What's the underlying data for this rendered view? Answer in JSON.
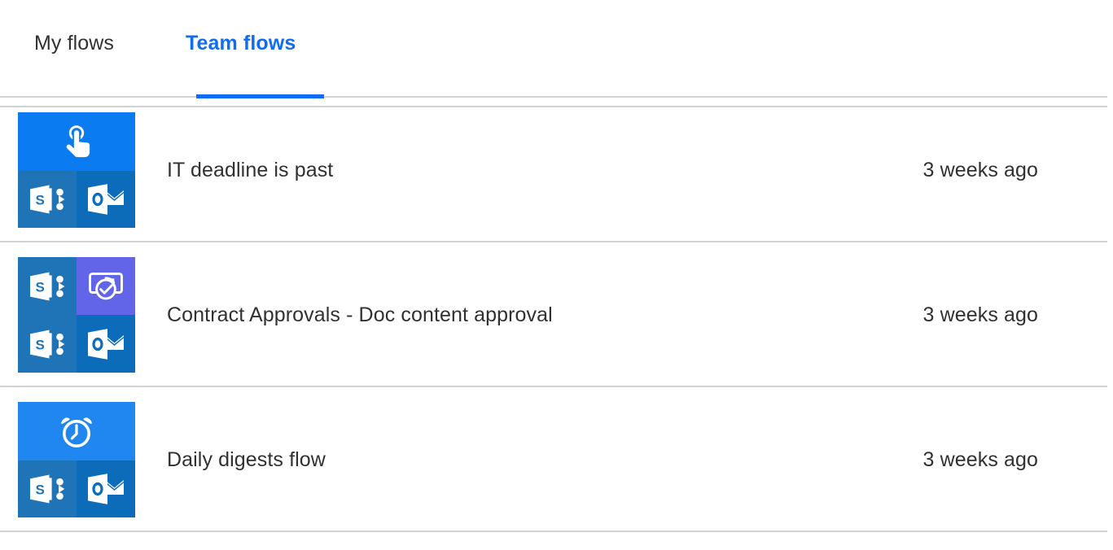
{
  "colors": {
    "accent": "#0f6cf5",
    "divider": "#d2d2d2",
    "text": "#323130",
    "tile_trigger_blue": "#0a7bf0",
    "tile_sharepoint_blue": "#1f73b7",
    "tile_outlook_blue": "#0d6cba",
    "tile_approvals_purple": "#6265e8"
  },
  "tabs": {
    "items": [
      {
        "label": "My flows",
        "active": false
      },
      {
        "label": "Team flows",
        "active": true
      }
    ]
  },
  "flows": [
    {
      "title": "IT deadline is past",
      "modified": "3 weeks ago",
      "layout": "top-wide",
      "icons": [
        {
          "name": "manual-trigger-button-icon",
          "bg": "#0a7bf0"
        },
        {
          "name": "sharepoint-icon",
          "bg": "#1f73b7"
        },
        {
          "name": "outlook-icon",
          "bg": "#0d6cba"
        }
      ]
    },
    {
      "title": "Contract Approvals - Doc content approval",
      "modified": "3 weeks ago",
      "layout": "quad",
      "icons": [
        {
          "name": "sharepoint-icon",
          "bg": "#1f73b7"
        },
        {
          "name": "approvals-icon",
          "bg": "#6265e8"
        },
        {
          "name": "sharepoint-icon",
          "bg": "#1f73b7"
        },
        {
          "name": "outlook-icon",
          "bg": "#0d6cba"
        }
      ]
    },
    {
      "title": "Daily digests flow",
      "modified": "3 weeks ago",
      "layout": "top-wide",
      "icons": [
        {
          "name": "recurrence-alarm-clock-icon",
          "bg": "#2187f0"
        },
        {
          "name": "sharepoint-icon",
          "bg": "#1f73b7"
        },
        {
          "name": "outlook-icon",
          "bg": "#0d6cba"
        }
      ]
    }
  ]
}
